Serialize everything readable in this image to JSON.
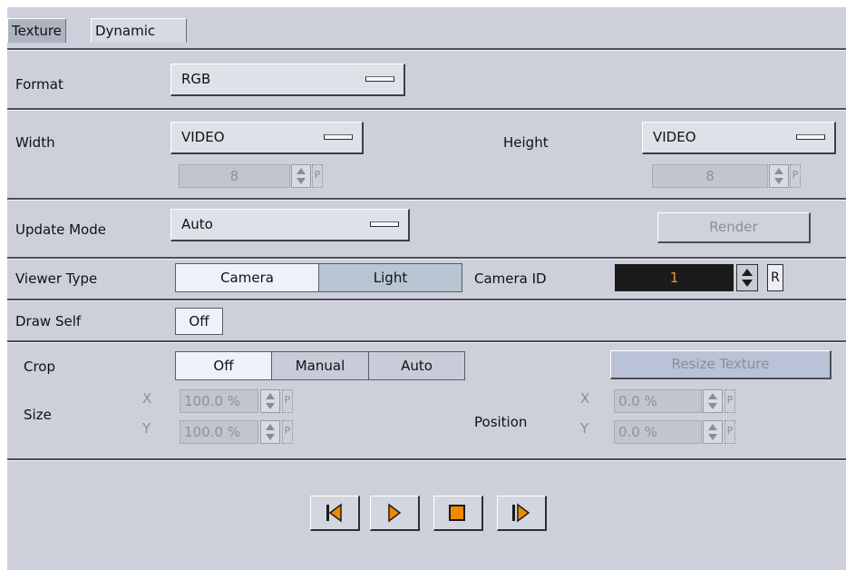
{
  "tabs": [
    {
      "label": "Texture",
      "active": true
    },
    {
      "label": "Dynamic",
      "active": false
    }
  ],
  "format": {
    "label": "Format",
    "value": "RGB"
  },
  "size_mode": {
    "width_label": "Width",
    "width_value": "VIDEO",
    "width_number": "8",
    "height_label": "Height",
    "height_value": "VIDEO",
    "height_number": "8",
    "p_glyph": "P"
  },
  "update_mode": {
    "label": "Update Mode",
    "value": "Auto",
    "render_label": "Render"
  },
  "viewer_type": {
    "label": "Viewer Type",
    "options": [
      "Camera",
      "Light"
    ],
    "selected": "Camera",
    "camera_id_label": "Camera ID",
    "camera_id_value": "1",
    "reset_label": "R"
  },
  "draw_self": {
    "label": "Draw Self",
    "value": "Off"
  },
  "crop": {
    "label": "Crop",
    "options": [
      "Off",
      "Manual",
      "Auto"
    ],
    "selected": "Off",
    "resize_label": "Resize Texture"
  },
  "size": {
    "label": "Size",
    "x_axis": "X",
    "y_axis": "Y",
    "x_value": "100.0 %",
    "y_value": "100.0 %"
  },
  "position": {
    "label": "Position",
    "x_axis": "X",
    "y_axis": "Y",
    "x_value": "0.0 %",
    "y_value": "0.0 %"
  },
  "colors": {
    "accent": "#f08a00",
    "panel": "#cdd0da",
    "dark_field": "#1b1b1b"
  },
  "playback": [
    "skip-to-start-icon",
    "play-icon",
    "stop-icon",
    "step-forward-icon"
  ]
}
